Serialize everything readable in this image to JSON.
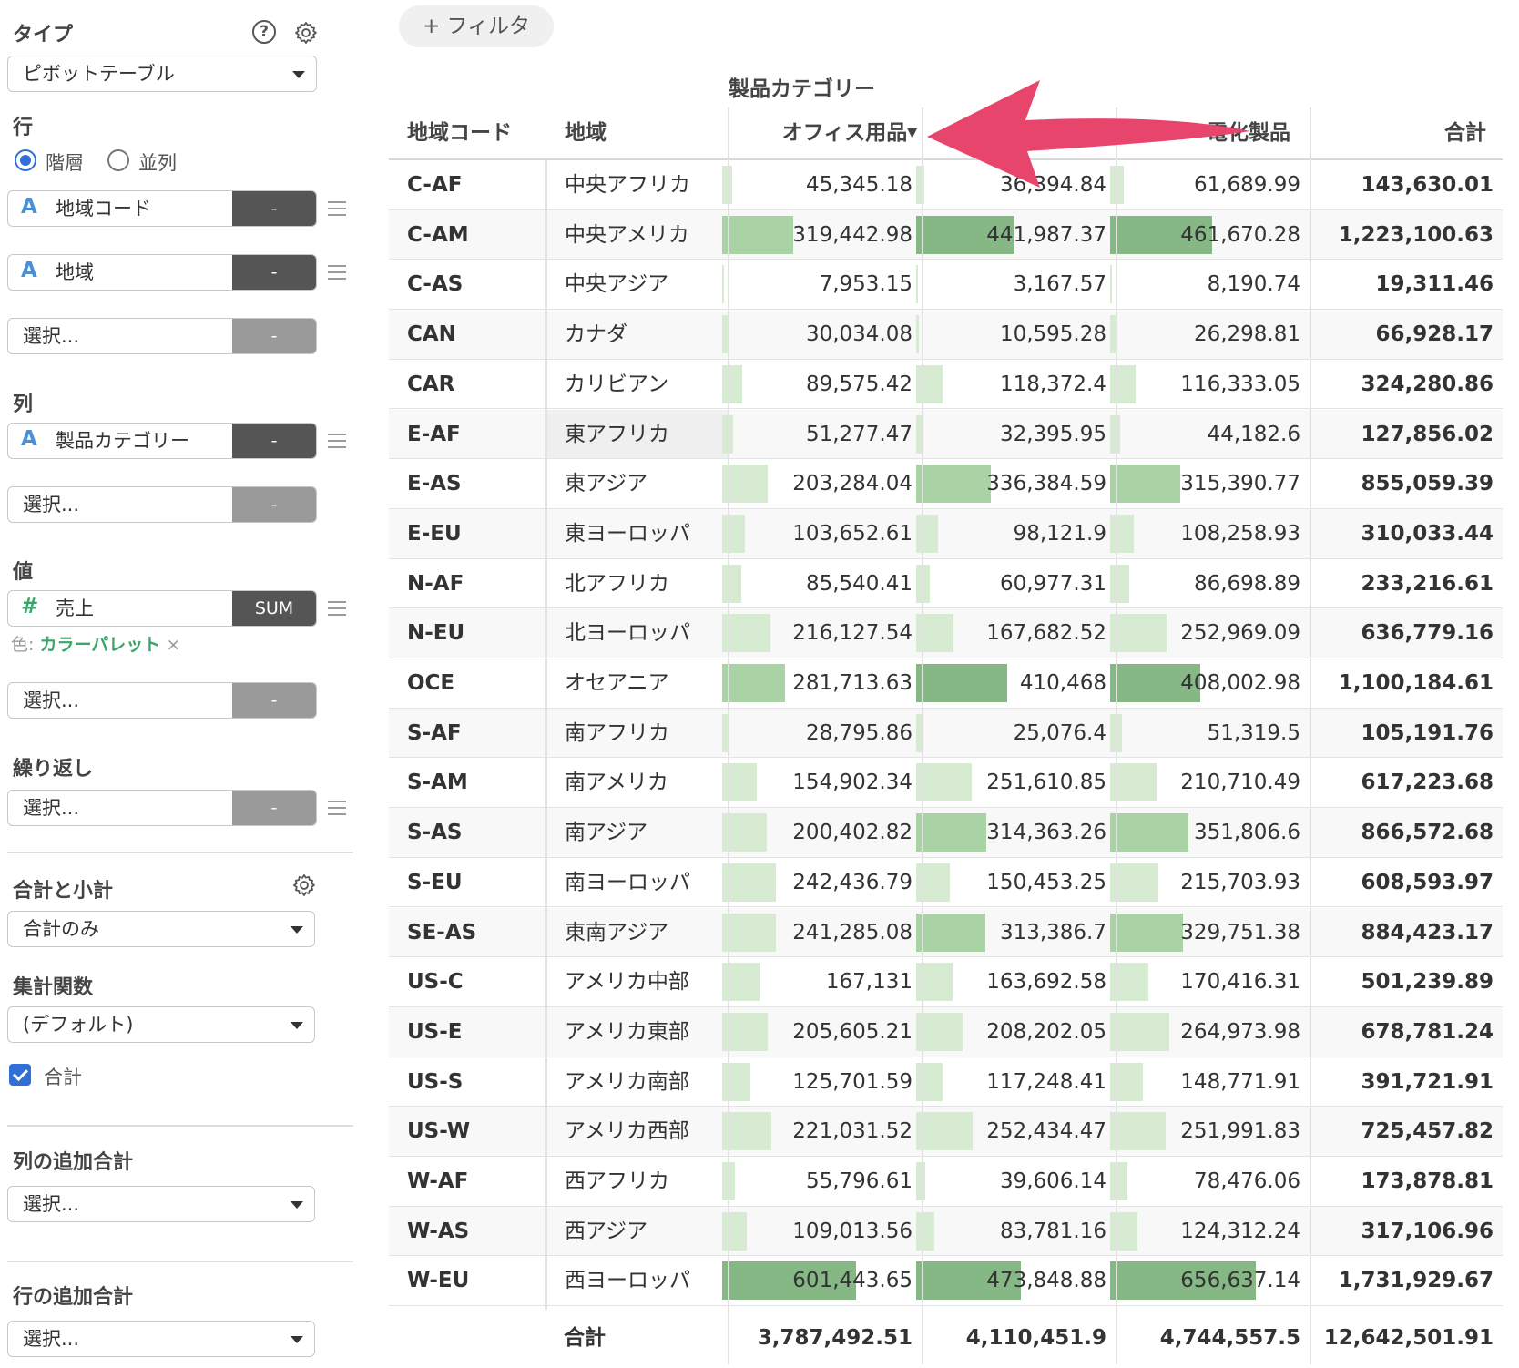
{
  "left_panel": {
    "type": {
      "title": "タイプ",
      "value": "ピボットテーブル"
    },
    "rows": {
      "title": "行",
      "layout_options": [
        {
          "label": "階層",
          "selected": true
        },
        {
          "label": "並列",
          "selected": false
        }
      ],
      "fields": [
        {
          "type": "A",
          "name": "地域コード",
          "button": "-"
        },
        {
          "type": "A",
          "name": "地域",
          "button": "-"
        }
      ],
      "placeholder": "選択...",
      "placeholder_button": "-"
    },
    "columns": {
      "title": "列",
      "fields": [
        {
          "type": "A",
          "name": "製品カテゴリー",
          "button": "-"
        }
      ],
      "placeholder": "選択...",
      "placeholder_button": "-"
    },
    "values": {
      "title": "値",
      "fields": [
        {
          "type": "#",
          "name": "売上",
          "button": "SUM"
        }
      ],
      "color_label": "色:",
      "color_value": "カラーパレット",
      "color_remove": "×",
      "placeholder": "選択...",
      "placeholder_button": "-"
    },
    "repeat": {
      "title": "繰り返し",
      "placeholder": "選択...",
      "placeholder_button": "-"
    },
    "totals": {
      "title": "合計と小計",
      "value": "合計のみ"
    },
    "aggregate": {
      "title": "集計関数",
      "value": "(デフォルト)"
    },
    "grand_total": {
      "label": "合計",
      "checked": true
    },
    "col_extra_total": {
      "title": "列の追加合計",
      "value": "選択..."
    },
    "row_extra_total": {
      "title": "行の追加合計",
      "value": "選択..."
    }
  },
  "filter_button": "+ フィルタ",
  "pivot": {
    "column_group_title": "製品カテゴリー",
    "headers": {
      "code": "地域コード",
      "region": "地域",
      "office": "オフィス用品",
      "electronics": "電化製品",
      "total": "合計"
    },
    "max_value": 656637.14,
    "rows": [
      {
        "code": "C-AF",
        "region": "中央アフリカ",
        "v": [
          "45,345.18",
          "36,394.84",
          "61,689.99"
        ],
        "n": [
          45345.18,
          36394.84,
          61689.99
        ],
        "total": "143,630.01"
      },
      {
        "code": "C-AM",
        "region": "中央アメリカ",
        "v": [
          "319,442.98",
          "441,987.37",
          "461,670.28"
        ],
        "n": [
          319442.98,
          441987.37,
          461670.28
        ],
        "total": "1,223,100.63"
      },
      {
        "code": "C-AS",
        "region": "中央アジア",
        "v": [
          "7,953.15",
          "3,167.57",
          "8,190.74"
        ],
        "n": [
          7953.15,
          3167.57,
          8190.74
        ],
        "total": "19,311.46"
      },
      {
        "code": "CAN",
        "region": "カナダ",
        "v": [
          "30,034.08",
          "10,595.28",
          "26,298.81"
        ],
        "n": [
          30034.08,
          10595.28,
          26298.81
        ],
        "total": "66,928.17"
      },
      {
        "code": "CAR",
        "region": "カリビアン",
        "v": [
          "89,575.42",
          "118,372.4",
          "116,333.05"
        ],
        "n": [
          89575.42,
          118372.4,
          116333.05
        ],
        "total": "324,280.86"
      },
      {
        "code": "E-AF",
        "region": "東アフリカ",
        "v": [
          "51,277.47",
          "32,395.95",
          "44,182.6"
        ],
        "n": [
          51277.47,
          32395.95,
          44182.6
        ],
        "total": "127,856.02"
      },
      {
        "code": "E-AS",
        "region": "東アジア",
        "v": [
          "203,284.04",
          "336,384.59",
          "315,390.77"
        ],
        "n": [
          203284.04,
          336384.59,
          315390.77
        ],
        "total": "855,059.39"
      },
      {
        "code": "E-EU",
        "region": "東ヨーロッパ",
        "v": [
          "103,652.61",
          "98,121.9",
          "108,258.93"
        ],
        "n": [
          103652.61,
          98121.9,
          108258.93
        ],
        "total": "310,033.44"
      },
      {
        "code": "N-AF",
        "region": "北アフリカ",
        "v": [
          "85,540.41",
          "60,977.31",
          "86,698.89"
        ],
        "n": [
          85540.41,
          60977.31,
          86698.89
        ],
        "total": "233,216.61"
      },
      {
        "code": "N-EU",
        "region": "北ヨーロッパ",
        "v": [
          "216,127.54",
          "167,682.52",
          "252,969.09"
        ],
        "n": [
          216127.54,
          167682.52,
          252969.09
        ],
        "total": "636,779.16"
      },
      {
        "code": "OCE",
        "region": "オセアニア",
        "v": [
          "281,713.63",
          "410,468",
          "408,002.98"
        ],
        "n": [
          281713.63,
          410468,
          408002.98
        ],
        "total": "1,100,184.61"
      },
      {
        "code": "S-AF",
        "region": "南アフリカ",
        "v": [
          "28,795.86",
          "25,076.4",
          "51,319.5"
        ],
        "n": [
          28795.86,
          25076.4,
          51319.5
        ],
        "total": "105,191.76"
      },
      {
        "code": "S-AM",
        "region": "南アメリカ",
        "v": [
          "154,902.34",
          "251,610.85",
          "210,710.49"
        ],
        "n": [
          154902.34,
          251610.85,
          210710.49
        ],
        "total": "617,223.68"
      },
      {
        "code": "S-AS",
        "region": "南アジア",
        "v": [
          "200,402.82",
          "314,363.26",
          "351,806.6"
        ],
        "n": [
          200402.82,
          314363.26,
          351806.6
        ],
        "total": "866,572.68"
      },
      {
        "code": "S-EU",
        "region": "南ヨーロッパ",
        "v": [
          "242,436.79",
          "150,453.25",
          "215,703.93"
        ],
        "n": [
          242436.79,
          150453.25,
          215703.93
        ],
        "total": "608,593.97"
      },
      {
        "code": "SE-AS",
        "region": "東南アジア",
        "v": [
          "241,285.08",
          "313,386.7",
          "329,751.38"
        ],
        "n": [
          241285.08,
          313386.7,
          329751.38
        ],
        "total": "884,423.17"
      },
      {
        "code": "US-C",
        "region": "アメリカ中部",
        "v": [
          "167,131",
          "163,692.58",
          "170,416.31"
        ],
        "n": [
          167131,
          163692.58,
          170416.31
        ],
        "total": "501,239.89"
      },
      {
        "code": "US-E",
        "region": "アメリカ東部",
        "v": [
          "205,605.21",
          "208,202.05",
          "264,973.98"
        ],
        "n": [
          205605.21,
          208202.05,
          264973.98
        ],
        "total": "678,781.24"
      },
      {
        "code": "US-S",
        "region": "アメリカ南部",
        "v": [
          "125,701.59",
          "117,248.41",
          "148,771.91"
        ],
        "n": [
          125701.59,
          117248.41,
          148771.91
        ],
        "total": "391,721.91"
      },
      {
        "code": "US-W",
        "region": "アメリカ西部",
        "v": [
          "221,031.52",
          "252,434.47",
          "251,991.83"
        ],
        "n": [
          221031.52,
          252434.47,
          251991.83
        ],
        "total": "725,457.82"
      },
      {
        "code": "W-AF",
        "region": "西アフリカ",
        "v": [
          "55,796.61",
          "39,606.14",
          "78,476.06"
        ],
        "n": [
          55796.61,
          39606.14,
          78476.06
        ],
        "total": "173,878.81"
      },
      {
        "code": "W-AS",
        "region": "西アジア",
        "v": [
          "109,013.56",
          "83,781.16",
          "124,312.24"
        ],
        "n": [
          109013.56,
          83781.16,
          124312.24
        ],
        "total": "317,106.96"
      },
      {
        "code": "W-EU",
        "region": "西ヨーロッパ",
        "v": [
          "601,443.65",
          "473,848.88",
          "656,637.14"
        ],
        "n": [
          601443.65,
          473848.88,
          656637.14
        ],
        "total": "1,731,929.67"
      }
    ],
    "footer": {
      "label": "合計",
      "values": [
        "3,787,492.51",
        "4,110,451.9",
        "4,744,557.5"
      ],
      "total": "12,642,501.91"
    }
  },
  "colors": {
    "bar_light": "#d6ebd2",
    "bar_mid": "#a9d3a4",
    "bar_dark": "#86b886",
    "accent": "#2f6fd6",
    "annotation_arrow": "#e8456c",
    "palette_link": "#3aa56a"
  }
}
